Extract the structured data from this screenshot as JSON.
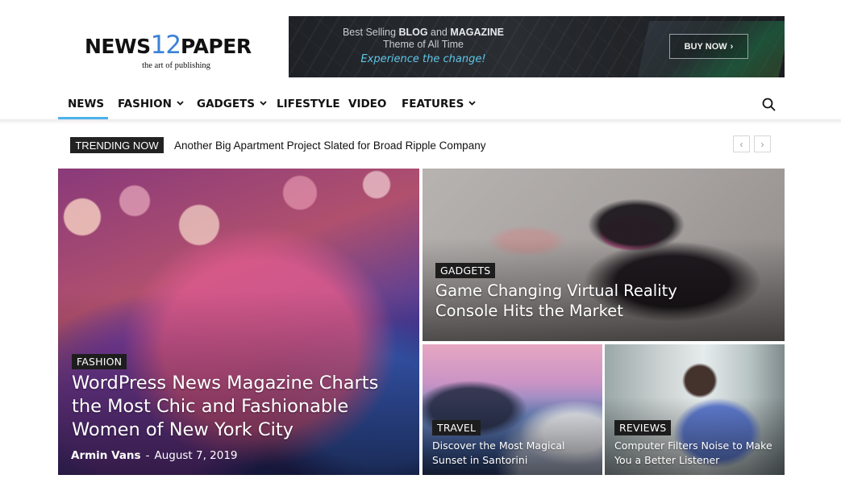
{
  "logo": {
    "part1": "NEWS",
    "part2": "12",
    "part3": "PAPER",
    "tagline": "the art of publishing"
  },
  "banner": {
    "line1_prefix": "Best Selling ",
    "line1_bold": "BLOG",
    "line1_mid": " and ",
    "line1_bold2": "MAGAZINE",
    "line2": "Theme of All Time",
    "line3": "Experience the change!",
    "button": "BUY NOW",
    "button_icon": "chevron-right"
  },
  "nav": {
    "items": [
      {
        "label": "NEWS",
        "active": true,
        "dropdown": false
      },
      {
        "label": "FASHION",
        "dropdown": true
      },
      {
        "label": "GADGETS",
        "dropdown": true
      },
      {
        "label": "LIFESTYLE",
        "dropdown": false
      },
      {
        "label": "VIDEO",
        "dropdown": false
      },
      {
        "label": "FEATURES",
        "dropdown": true
      }
    ],
    "search_icon": "search-icon",
    "accent": "#4db2ec"
  },
  "trending": {
    "label": "TRENDING NOW",
    "headline": "Another Big Apartment Project Slated for Broad Ripple Company",
    "prev": "‹",
    "next": "›"
  },
  "cards": {
    "main": {
      "category": "FASHION",
      "title_lines": [
        "WordPress News Magazine Charts",
        "the Most Chic and Fashionable",
        "Women of New York City"
      ],
      "author": "Armin Vans",
      "separator": "-",
      "date": "August 7, 2019"
    },
    "vr": {
      "category": "GADGETS",
      "title_lines": [
        "Game Changing Virtual Reality",
        "Console Hits the Market"
      ]
    },
    "travel": {
      "category": "TRAVEL",
      "title_lines": [
        "Discover the Most Magical",
        "Sunset in Santorini"
      ]
    },
    "reviews": {
      "category": "REVIEWS",
      "title_lines": [
        "Computer Filters Noise to Make",
        "You a Better Listener"
      ]
    }
  }
}
